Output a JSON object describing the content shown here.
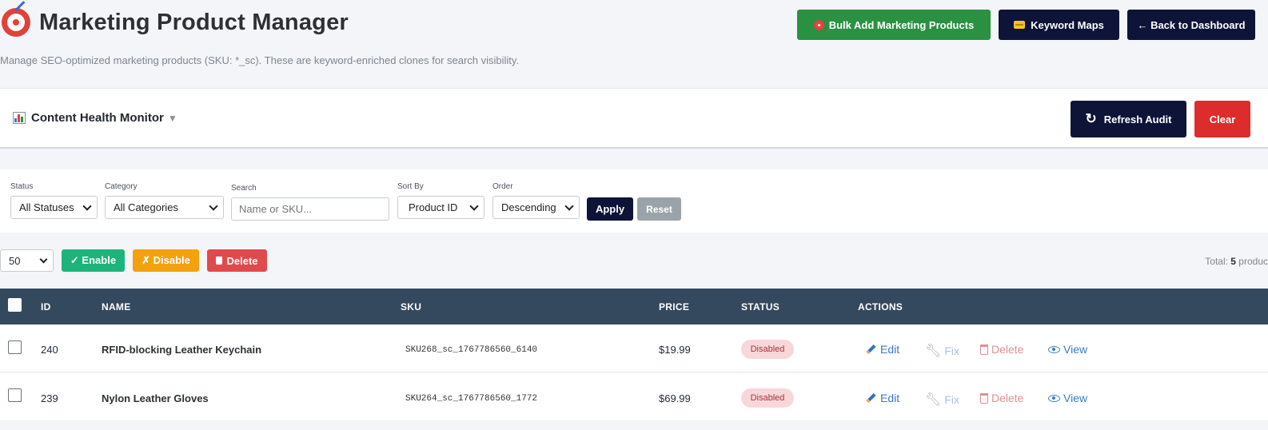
{
  "header": {
    "title": "Marketing Product Manager",
    "subtitle": "Manage SEO-optimized marketing products (SKU: *_sc). These are keyword-enriched clones for search visibility.",
    "actions": {
      "bulk_add": "Bulk Add Marketing Products",
      "keyword_maps": "Keyword Maps",
      "back": "← Back to Dashboard"
    }
  },
  "health": {
    "title": "Content Health Monitor",
    "refresh": "Refresh Audit",
    "clear": "Clear"
  },
  "filters": {
    "status": {
      "label": "Status",
      "value": "All Statuses"
    },
    "category": {
      "label": "Category",
      "value": "All Categories"
    },
    "search": {
      "label": "Search",
      "placeholder": "Name or SKU..."
    },
    "sort_by": {
      "label": "Sort By",
      "value": "Product ID"
    },
    "order": {
      "label": "Order",
      "value": "Descending"
    },
    "apply": "Apply",
    "reset": "Reset"
  },
  "bulk": {
    "per_page": "50",
    "enable": "✓ Enable",
    "disable": "✗ Disable",
    "delete": "Delete",
    "total_label": "Total: ",
    "total_count": "5",
    "total_suffix": " produc"
  },
  "table": {
    "columns": [
      "ID",
      "NAME",
      "SKU",
      "PRICE",
      "STATUS",
      "ACTIONS"
    ],
    "rows": [
      {
        "id": "240",
        "name": "RFID-blocking Leather Keychain",
        "sku": "SKU268_sc_1767786560_6140",
        "price": "$19.99",
        "status": "Disabled"
      },
      {
        "id": "239",
        "name": "Nylon Leather Gloves",
        "sku": "SKU264_sc_1767786560_1772",
        "price": "$69.99",
        "status": "Disabled"
      }
    ],
    "actions": {
      "edit": "Edit",
      "fix": "Fix",
      "delete": "Delete",
      "view": "View"
    }
  },
  "colors": {
    "navy": "#0d1438",
    "green": "#2b9142",
    "red": "#dd2c2c",
    "table_header": "#34495e",
    "enable": "#1db47b",
    "disable": "#f4a10e",
    "delete": "#e04a4d"
  }
}
